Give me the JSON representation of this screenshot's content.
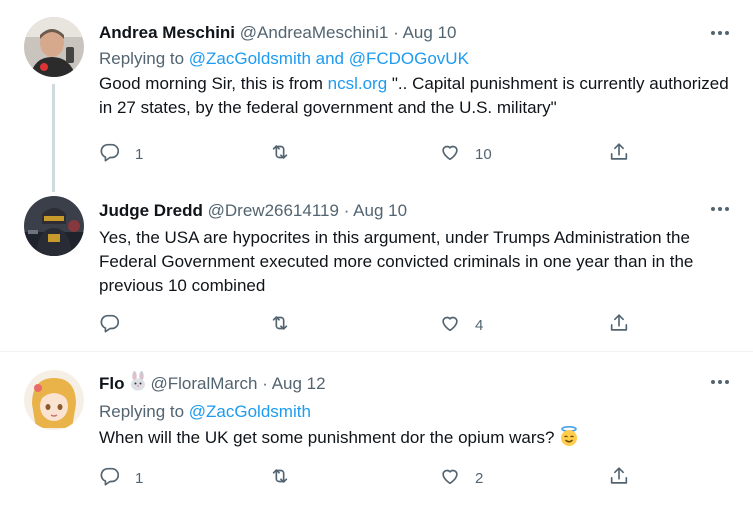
{
  "tweets": [
    {
      "name": "Andrea Meschini",
      "handle": "@AndreaMeschini1",
      "sep": "·",
      "date": "Aug 10",
      "reply_prefix": "Replying to ",
      "reply_mentions": "@ZacGoldsmith and @FCDOGovUK",
      "text_pre": "Good morning Sir, this is from ",
      "text_link": "ncsl.org",
      "text_post": " \".. Capital punishment is currently authorized in 27 states, by the federal government and the U.S. military\"",
      "replies": "1",
      "retweets": "",
      "likes": "10"
    },
    {
      "name": "Judge Dredd",
      "handle": "@Drew26614119",
      "sep": "·",
      "date": "Aug 10",
      "text": "Yes, the USA are hypocrites in this argument, under Trumps Administration the Federal Government executed more convicted criminals in one year than in the previous 10 combined",
      "replies": "",
      "retweets": "",
      "likes": "4"
    },
    {
      "name": "Flo",
      "name_emoji": "rabbit-face-emoji",
      "handle": "@FloralMarch",
      "sep": "·",
      "date": "Aug 12",
      "reply_prefix": "Replying to ",
      "reply_mentions": "@ZacGoldsmith",
      "text": "When will the UK get some punishment dor the opium wars?",
      "text_emoji": "smiling-face-with-halo-emoji",
      "replies": "1",
      "retweets": "",
      "likes": "2"
    }
  ],
  "icons": {
    "more": "more-horizontal-icon",
    "reply": "reply-icon",
    "retweet": "retweet-icon",
    "like": "heart-icon",
    "share": "share-icon"
  },
  "colors": {
    "link": "#1d9bf0",
    "secondary_text": "#536471",
    "primary_text": "#0f1419",
    "thread_line": "#cfd9de",
    "divider": "#eff3f4"
  }
}
